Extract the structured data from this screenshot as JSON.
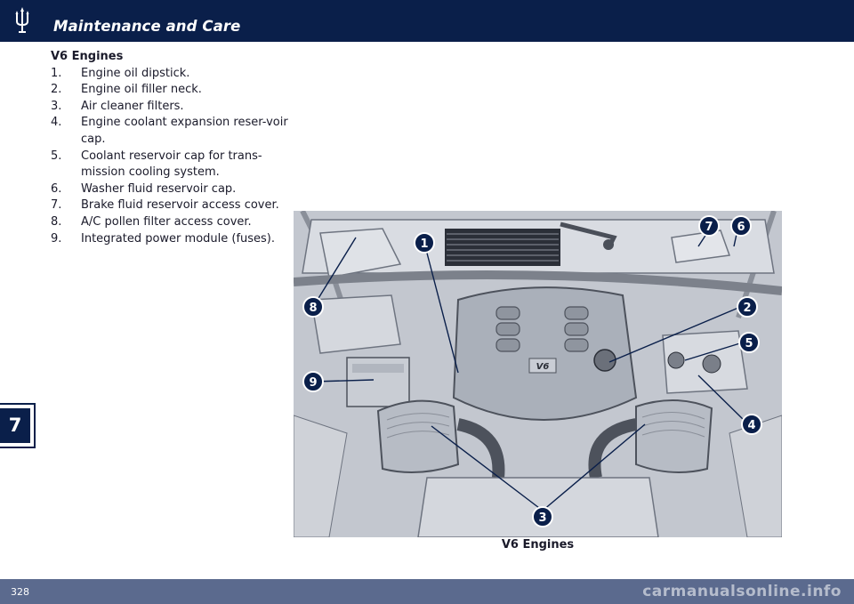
{
  "header": {
    "title": "Maintenance and Care",
    "logo_icon": "trident-logo-icon",
    "background": "#0a1f4a"
  },
  "section": {
    "title": "V6 Engines",
    "items": [
      {
        "number": "1.",
        "text": "Engine oil dipstick."
      },
      {
        "number": "2.",
        "text": "Engine oil filler neck."
      },
      {
        "number": "3.",
        "text": "Air cleaner filters."
      },
      {
        "number": "4.",
        "text": "Engine coolant expansion reser-voir cap."
      },
      {
        "number": "5.",
        "text": "Coolant reservoir cap for trans-mission cooling system."
      },
      {
        "number": "6.",
        "text": "Washer fluid reservoir cap."
      },
      {
        "number": "7.",
        "text": "Brake fluid reservoir access cover."
      },
      {
        "number": "8.",
        "text": "A/C pollen filter access cover."
      },
      {
        "number": "9.",
        "text": "Integrated power module (fuses)."
      }
    ]
  },
  "figure": {
    "caption": "V6 Engines",
    "engine_badge": "V6",
    "callouts": [
      "1",
      "2",
      "3",
      "4",
      "5",
      "6",
      "7",
      "8",
      "9"
    ]
  },
  "chapter_tab": {
    "label": "7"
  },
  "footer": {
    "page_number": "328",
    "watermark": "carmanualsonline.info",
    "background": "#5b6a8e"
  }
}
